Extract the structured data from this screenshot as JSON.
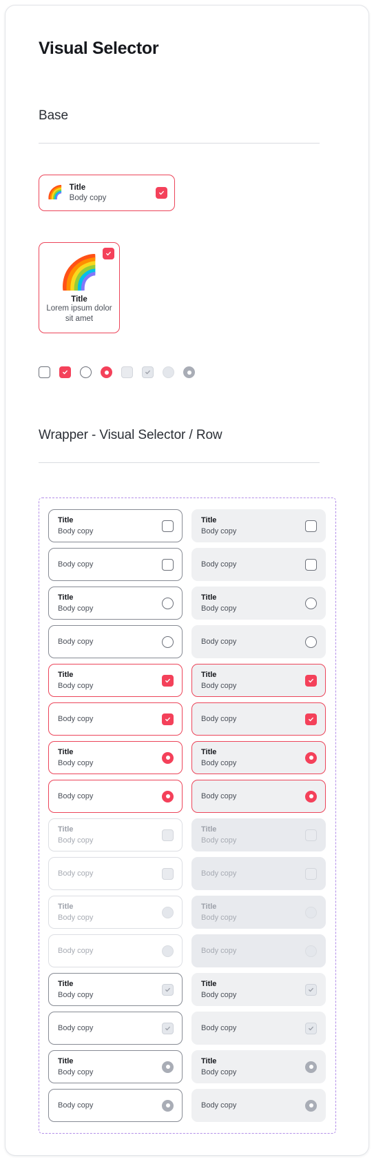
{
  "page": {
    "title": "Visual Selector"
  },
  "sections": {
    "base": {
      "heading": "Base"
    },
    "wrapper": {
      "heading": "Wrapper - Visual Selector / Row"
    }
  },
  "colors": {
    "accent_red": "#F4415A",
    "accent_red_border": "#EC4459",
    "wrapper_dashed_purple": "#B28DE8",
    "surface_grey": "#EFF0F2",
    "surface_grey_disabled": "#E8EAEE",
    "text_primary": "#16181D",
    "text_body": "#4A4F58",
    "text_disabled": "#9DA1AA"
  },
  "base_card_row": {
    "icon": "rainbow-icon",
    "icon_glyph": "🌈",
    "title": "Title",
    "body": "Body copy",
    "control": "checkbox-checked"
  },
  "base_card_column": {
    "icon": "rainbow-icon",
    "icon_glyph": "🌈",
    "title": "Title",
    "body": "Lorem ipsum dolor sit amet",
    "control": "checkbox-checked"
  },
  "swatches": [
    {
      "name": "checkbox-unchecked",
      "type": "checkbox",
      "checked": false,
      "disabled": false
    },
    {
      "name": "checkbox-checked",
      "type": "checkbox",
      "checked": true,
      "disabled": false
    },
    {
      "name": "radio-unchecked",
      "type": "radio",
      "checked": false,
      "disabled": false
    },
    {
      "name": "radio-checked",
      "type": "radio",
      "checked": true,
      "disabled": false
    },
    {
      "name": "checkbox-unchecked-disabled",
      "type": "checkbox",
      "checked": false,
      "disabled": true
    },
    {
      "name": "checkbox-checked-disabled",
      "type": "checkbox",
      "checked": true,
      "disabled": true
    },
    {
      "name": "radio-unchecked-disabled",
      "type": "radio",
      "checked": false,
      "disabled": true
    },
    {
      "name": "radio-checked-disabled",
      "type": "radio",
      "checked": true,
      "disabled": true
    }
  ],
  "wrapper_rows": [
    {
      "title": "Title",
      "body": "Body copy",
      "has_title": true,
      "control": "checkbox",
      "state": "default"
    },
    {
      "title": "Title",
      "body": "Body copy",
      "has_title": true,
      "control": "checkbox",
      "state": "default"
    },
    {
      "title": "",
      "body": "Body copy",
      "has_title": false,
      "control": "checkbox",
      "state": "default"
    },
    {
      "title": "",
      "body": "Body copy",
      "has_title": false,
      "control": "checkbox",
      "state": "default"
    },
    {
      "title": "Title",
      "body": "Body copy",
      "has_title": true,
      "control": "radio",
      "state": "default"
    },
    {
      "title": "Title",
      "body": "Body copy",
      "has_title": true,
      "control": "radio",
      "state": "default"
    },
    {
      "title": "",
      "body": "Body copy",
      "has_title": false,
      "control": "radio",
      "state": "default"
    },
    {
      "title": "",
      "body": "Body copy",
      "has_title": false,
      "control": "radio",
      "state": "default"
    },
    {
      "title": "Title",
      "body": "Body copy",
      "has_title": true,
      "control": "checkbox",
      "state": "selected"
    },
    {
      "title": "Title",
      "body": "Body copy",
      "has_title": true,
      "control": "checkbox",
      "state": "selected"
    },
    {
      "title": "",
      "body": "Body copy",
      "has_title": false,
      "control": "checkbox",
      "state": "selected"
    },
    {
      "title": "",
      "body": "Body copy",
      "has_title": false,
      "control": "checkbox",
      "state": "selected"
    },
    {
      "title": "Title",
      "body": "Body copy",
      "has_title": true,
      "control": "radio",
      "state": "selected"
    },
    {
      "title": "Title",
      "body": "Body copy",
      "has_title": true,
      "control": "radio",
      "state": "selected"
    },
    {
      "title": "",
      "body": "Body copy",
      "has_title": false,
      "control": "radio",
      "state": "selected"
    },
    {
      "title": "",
      "body": "Body copy",
      "has_title": false,
      "control": "radio",
      "state": "selected"
    },
    {
      "title": "Title",
      "body": "Body copy",
      "has_title": true,
      "control": "checkbox",
      "state": "disabled"
    },
    {
      "title": "Title",
      "body": "Body copy",
      "has_title": true,
      "control": "checkbox",
      "state": "disabled"
    },
    {
      "title": "",
      "body": "Body copy",
      "has_title": false,
      "control": "checkbox",
      "state": "disabled"
    },
    {
      "title": "",
      "body": "Body copy",
      "has_title": false,
      "control": "checkbox",
      "state": "disabled"
    },
    {
      "title": "Title",
      "body": "Body copy",
      "has_title": true,
      "control": "radio",
      "state": "disabled"
    },
    {
      "title": "Title",
      "body": "Body copy",
      "has_title": true,
      "control": "radio",
      "state": "disabled"
    },
    {
      "title": "",
      "body": "Body copy",
      "has_title": false,
      "control": "radio",
      "state": "disabled"
    },
    {
      "title": "",
      "body": "Body copy",
      "has_title": false,
      "control": "radio",
      "state": "disabled"
    },
    {
      "title": "Title",
      "body": "Body copy",
      "has_title": true,
      "control": "checkbox",
      "state": "disabled-checked"
    },
    {
      "title": "Title",
      "body": "Body copy",
      "has_title": true,
      "control": "checkbox",
      "state": "disabled-checked"
    },
    {
      "title": "",
      "body": "Body copy",
      "has_title": false,
      "control": "checkbox",
      "state": "disabled-checked"
    },
    {
      "title": "",
      "body": "Body copy",
      "has_title": false,
      "control": "checkbox",
      "state": "disabled-checked"
    },
    {
      "title": "Title",
      "body": "Body copy",
      "has_title": true,
      "control": "radio",
      "state": "disabled-checked"
    },
    {
      "title": "Title",
      "body": "Body copy",
      "has_title": true,
      "control": "radio",
      "state": "disabled-checked"
    },
    {
      "title": "",
      "body": "Body copy",
      "has_title": false,
      "control": "radio",
      "state": "disabled-checked"
    },
    {
      "title": "",
      "body": "Body copy",
      "has_title": false,
      "control": "radio",
      "state": "disabled-checked"
    }
  ]
}
